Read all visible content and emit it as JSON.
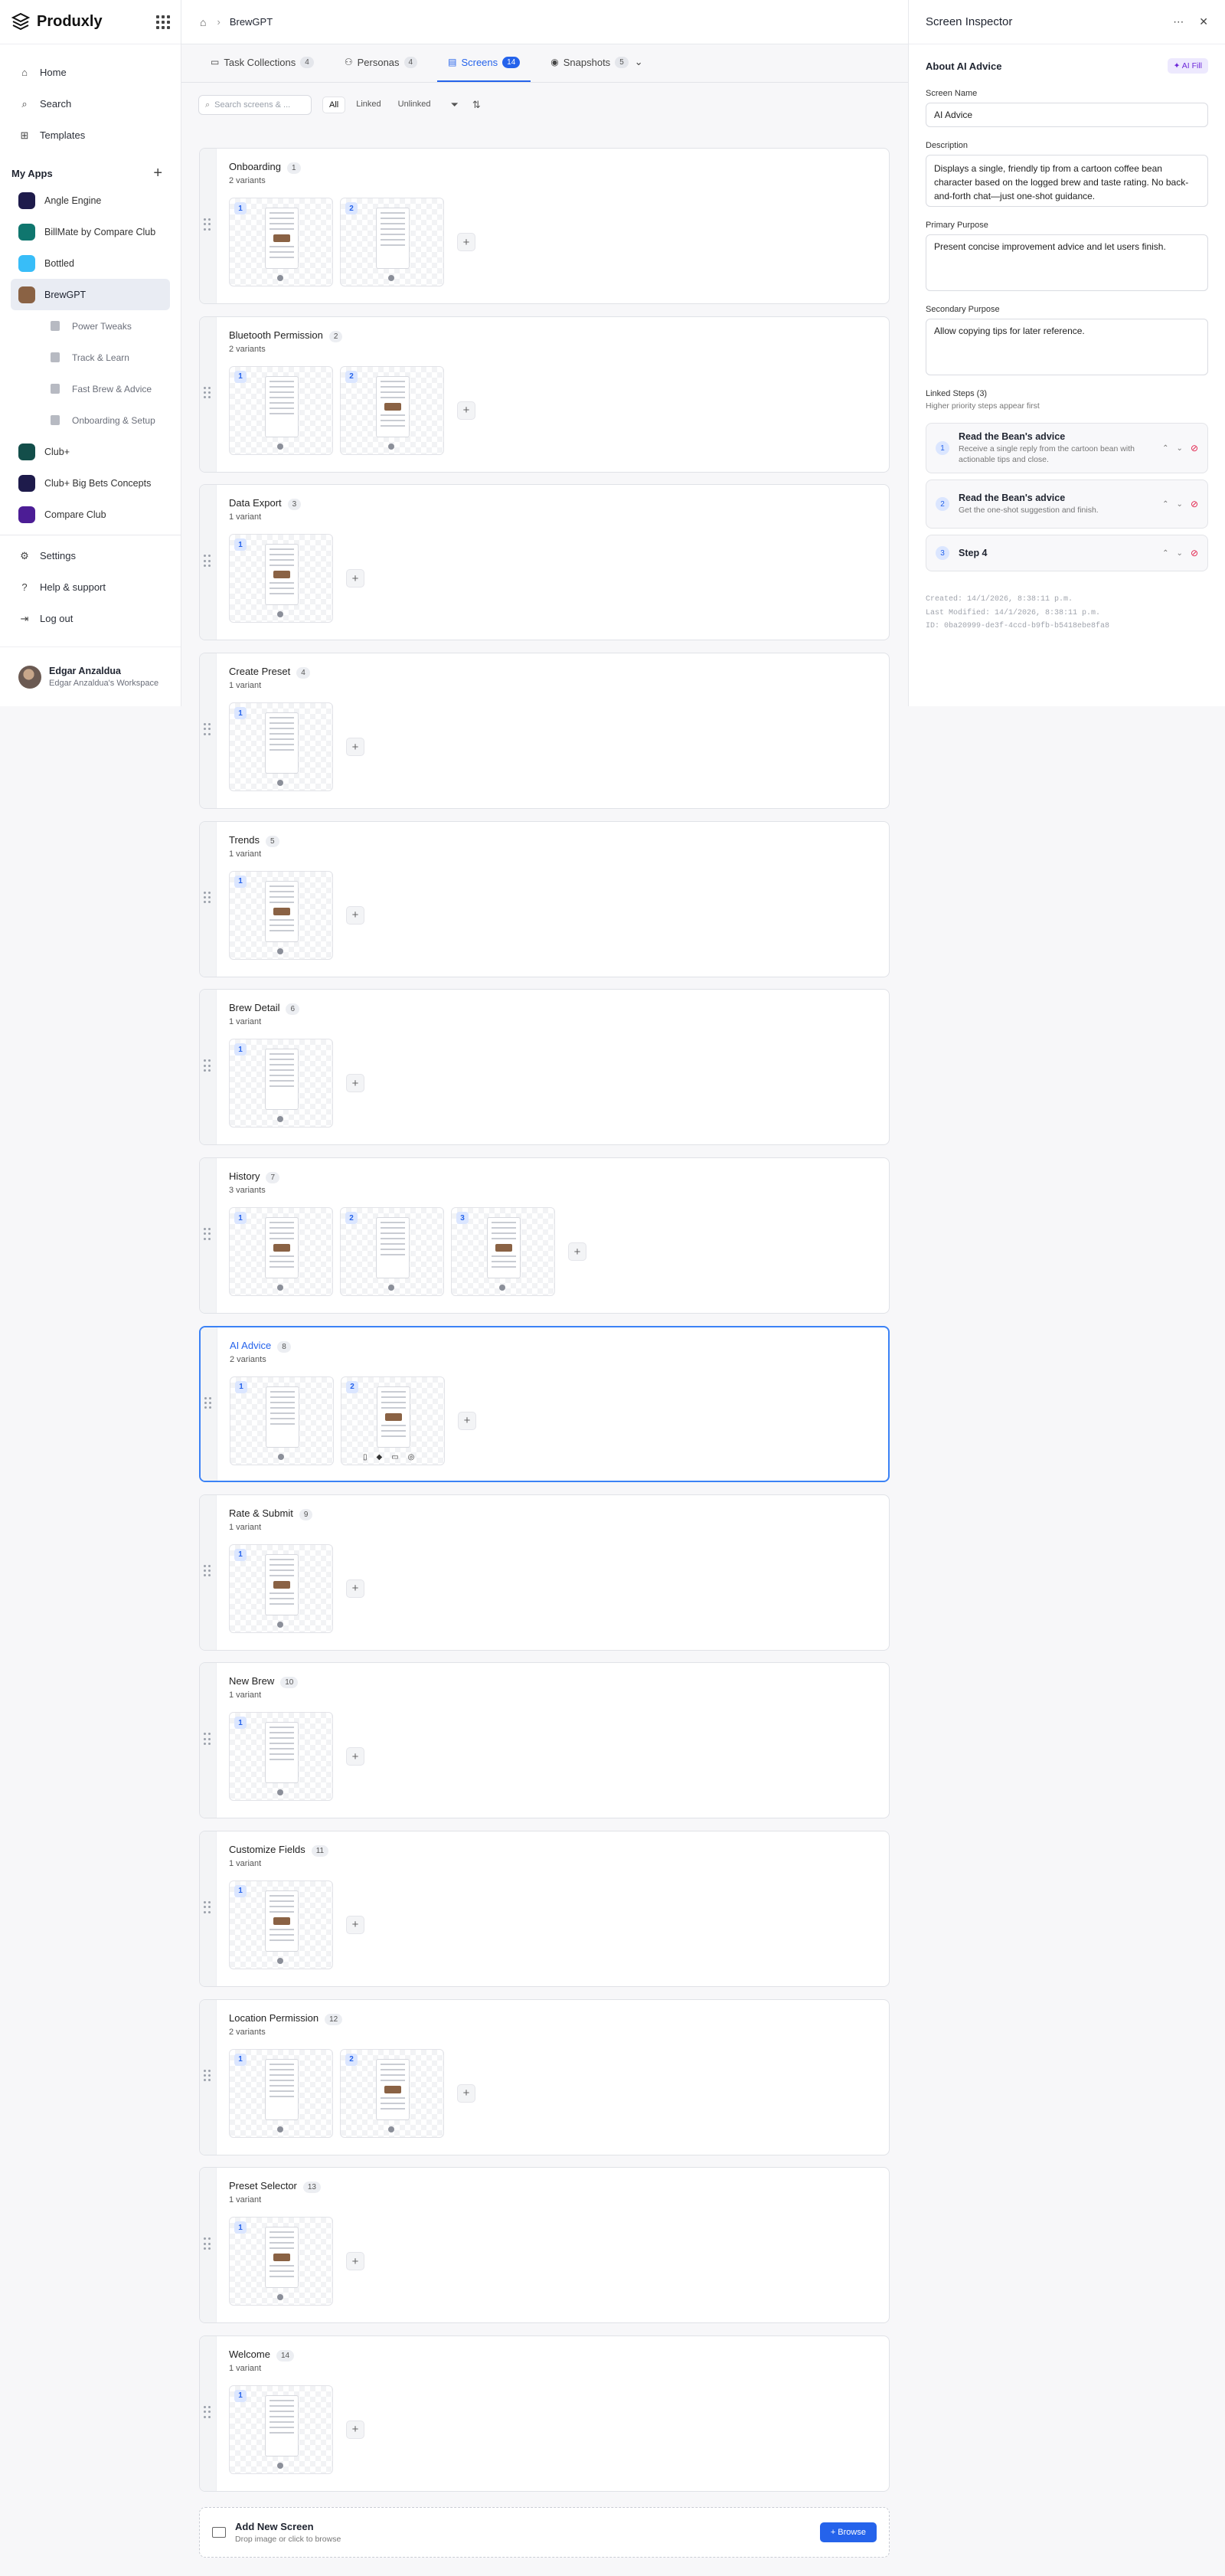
{
  "sidebar": {
    "brand": "Produxly",
    "nav": [
      {
        "label": "Home",
        "icon": "home-icon",
        "glyph": "⌂"
      },
      {
        "label": "Search",
        "icon": "search-icon",
        "glyph": "⌕"
      },
      {
        "label": "Templates",
        "icon": "templates-icon",
        "glyph": "⊞"
      }
    ],
    "my_apps_label": "My Apps",
    "apps": [
      {
        "label": "Angle Engine",
        "color": "#1e1b4b",
        "active": false
      },
      {
        "label": "BillMate by Compare Club",
        "color": "#0f766e",
        "active": false
      },
      {
        "label": "Bottled",
        "color": "#38bdf8",
        "active": false
      },
      {
        "label": "BrewGPT",
        "color": "#8a6244",
        "active": true
      }
    ],
    "sub_items": [
      "Power Tweaks",
      "Track & Learn",
      "Fast Brew & Advice",
      "Onboarding & Setup"
    ],
    "apps_after": [
      {
        "label": "Club+",
        "color": "#134e4a"
      },
      {
        "label": "Club+ Big Bets Concepts",
        "color": "#1e1b4b"
      },
      {
        "label": "Compare Club",
        "color": "#4c1d95"
      }
    ],
    "bottom": [
      {
        "label": "Settings",
        "icon": "settings-icon",
        "glyph": "⚙"
      },
      {
        "label": "Help & support",
        "icon": "help-icon",
        "glyph": "?"
      },
      {
        "label": "Log out",
        "icon": "logout-icon",
        "glyph": "⇥"
      }
    ],
    "user": {
      "name": "Edgar Anzaldua",
      "workspace": "Edgar Anzaldua's Workspace"
    }
  },
  "breadcrumb": {
    "current": "BrewGPT"
  },
  "tabs": [
    {
      "label": "Task Collections",
      "count": "4",
      "active": false
    },
    {
      "label": "Personas",
      "count": "4",
      "active": false
    },
    {
      "label": "Screens",
      "count": "14",
      "active": true
    },
    {
      "label": "Snapshots",
      "count": "5",
      "active": false
    }
  ],
  "filters": {
    "search_placeholder": "Search screens & ...",
    "options": [
      "All",
      "Linked",
      "Unlinked"
    ],
    "active": "All"
  },
  "screens": [
    {
      "title": "Onboarding",
      "num": "1",
      "variants_label": "2 variants",
      "thumbs": 2
    },
    {
      "title": "Bluetooth Permission",
      "num": "2",
      "variants_label": "2 variants",
      "thumbs": 2
    },
    {
      "title": "Data Export",
      "num": "3",
      "variants_label": "1 variant",
      "thumbs": 1
    },
    {
      "title": "Create Preset",
      "num": "4",
      "variants_label": "1 variant",
      "thumbs": 1
    },
    {
      "title": "Trends",
      "num": "5",
      "variants_label": "1 variant",
      "thumbs": 1
    },
    {
      "title": "Brew Detail",
      "num": "6",
      "variants_label": "1 variant",
      "thumbs": 1
    },
    {
      "title": "History",
      "num": "7",
      "variants_label": "3 variants",
      "thumbs": 3
    },
    {
      "title": "AI Advice",
      "num": "8",
      "variants_label": "2 variants",
      "thumbs": 2,
      "selected": true
    },
    {
      "title": "Rate & Submit",
      "num": "9",
      "variants_label": "1 variant",
      "thumbs": 1
    },
    {
      "title": "New Brew",
      "num": "10",
      "variants_label": "1 variant",
      "thumbs": 1
    },
    {
      "title": "Customize Fields",
      "num": "11",
      "variants_label": "1 variant",
      "thumbs": 1
    },
    {
      "title": "Location Permission",
      "num": "12",
      "variants_label": "2 variants",
      "thumbs": 2
    },
    {
      "title": "Preset Selector",
      "num": "13",
      "variants_label": "1 variant",
      "thumbs": 1
    },
    {
      "title": "Welcome",
      "num": "14",
      "variants_label": "1 variant",
      "thumbs": 1
    }
  ],
  "add_new": {
    "title": "Add New Screen",
    "subtitle": "Drop image or click to browse",
    "button": "+ Browse"
  },
  "inspector": {
    "title": "Screen Inspector",
    "about": "About AI Advice",
    "ai_fill": "✦ AI Fill",
    "screen_name_label": "Screen Name",
    "screen_name": "AI Advice",
    "description_label": "Description",
    "description": "Displays a single, friendly tip from a cartoon coffee bean character based on the logged brew and taste rating. No back-and-forth chat—just one-shot guidance.",
    "primary_label": "Primary Purpose",
    "primary": "Present concise improvement advice and let users finish.",
    "secondary_label": "Secondary Purpose",
    "secondary": "Allow copying tips for later reference.",
    "linked_title": "Linked Steps (3)",
    "linked_sub": "Higher priority steps appear first",
    "steps": [
      {
        "n": "1",
        "title": "Read the Bean's advice",
        "desc": "Receive a single reply from the cartoon bean with actionable tips and close."
      },
      {
        "n": "2",
        "title": "Read the Bean's advice",
        "desc": "Get the one-shot suggestion and finish."
      },
      {
        "n": "3",
        "title": "Step 4",
        "desc": ""
      }
    ],
    "meta": {
      "created": "Created: 14/1/2026, 8:38:11 p.m.",
      "modified": "Last Modified: 14/1/2026, 8:38:11 p.m.",
      "id": "ID: 0ba20999-de3f-4ccd-b9fb-b5418ebe8fa8"
    }
  }
}
